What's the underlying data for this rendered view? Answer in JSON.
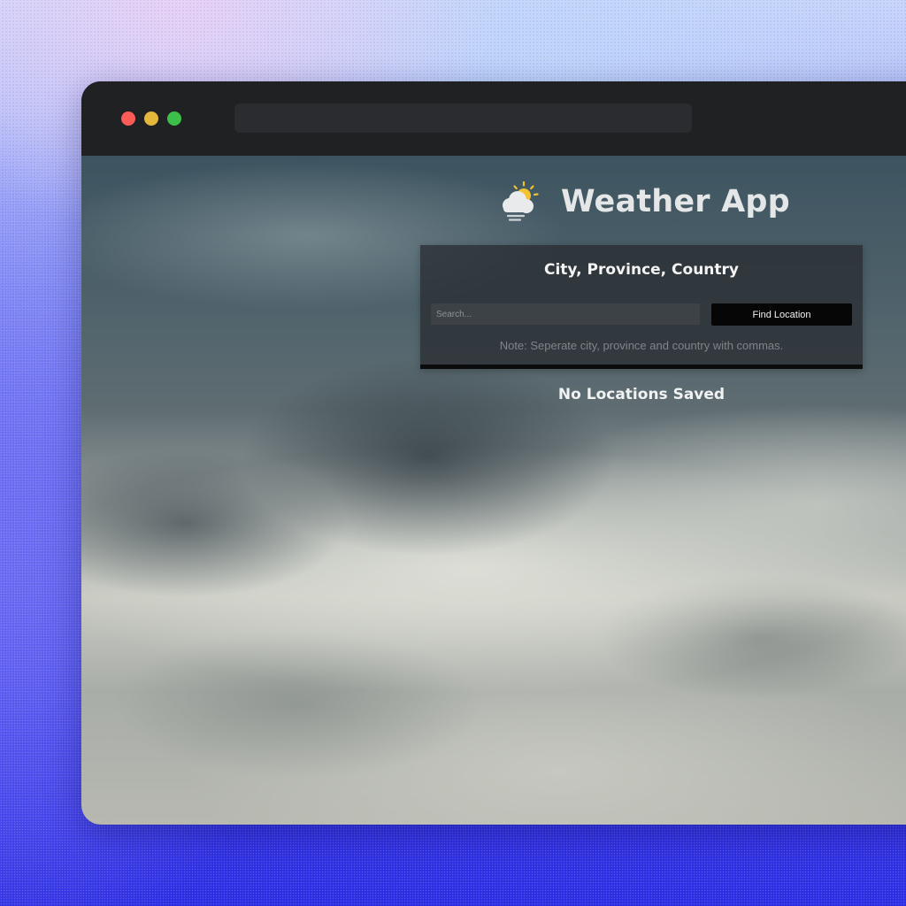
{
  "app": {
    "title": "Weather App",
    "logo_icon": "partly-cloudy-icon"
  },
  "browser": {
    "controls": [
      "close",
      "minimize",
      "maximize"
    ],
    "address_bar": ""
  },
  "search_panel": {
    "title": "City, Province, Country",
    "search_placeholder": "Search...",
    "search_value": "",
    "button_label": "Find Location",
    "note": "Note: Seperate city, province and country with commas."
  },
  "saved_locations": {
    "empty_message": "No Locations Saved"
  },
  "colors": {
    "close": "#fb5c57",
    "minimize": "#e3b83b",
    "maximize": "#3dbe4a",
    "sun": "#f2c230",
    "button_bg": "#060606"
  }
}
